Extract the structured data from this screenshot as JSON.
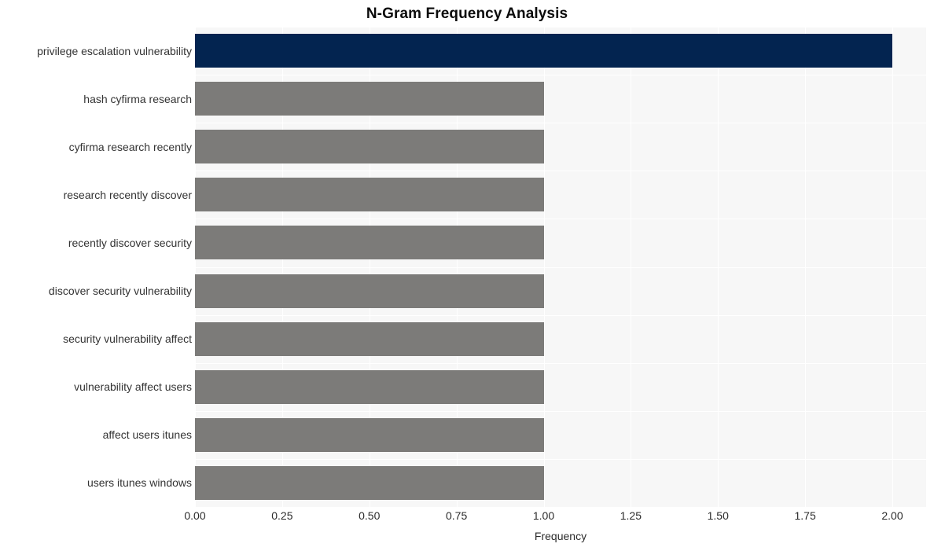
{
  "chart_data": {
    "type": "bar",
    "orientation": "horizontal",
    "title": "N-Gram Frequency Analysis",
    "xlabel": "Frequency",
    "ylabel": "",
    "xlim": [
      0,
      2.0
    ],
    "xticks": [
      "0.00",
      "0.25",
      "0.50",
      "0.75",
      "1.00",
      "1.25",
      "1.50",
      "1.75",
      "2.00"
    ],
    "xtick_values": [
      0,
      0.25,
      0.5,
      0.75,
      1.0,
      1.25,
      1.5,
      1.75,
      2.0
    ],
    "grid": true,
    "legend": "none",
    "categories": [
      "privilege escalation vulnerability",
      "hash cyfirma research",
      "cyfirma research recently",
      "research recently discover",
      "recently discover security",
      "discover security vulnerability",
      "security vulnerability affect",
      "vulnerability affect users",
      "affect users itunes",
      "users itunes windows"
    ],
    "values": [
      2,
      1,
      1,
      1,
      1,
      1,
      1,
      1,
      1,
      1
    ],
    "bar_colors": [
      "#032450",
      "#7c7b79",
      "#7c7b79",
      "#7c7b79",
      "#7c7b79",
      "#7c7b79",
      "#7c7b79",
      "#7c7b79",
      "#7c7b79",
      "#7c7b79"
    ]
  },
  "style": {
    "plot_background": "#f7f7f7",
    "page_background": "#ffffff",
    "gridline_color": "#ffffff",
    "highlight_color": "#032450",
    "bar_color": "#7c7b79",
    "text_color": "#333333",
    "title_color": "#0b0b0b"
  }
}
